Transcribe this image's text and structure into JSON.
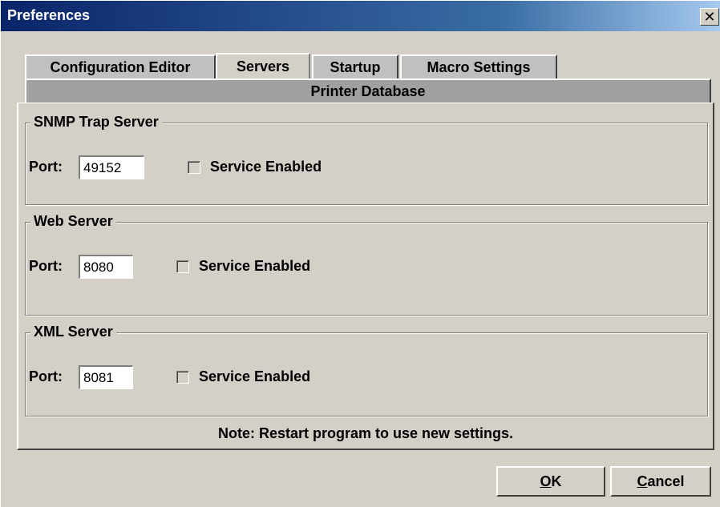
{
  "window": {
    "title": "Preferences",
    "close_glyph": "✕"
  },
  "tabs": {
    "row1": [
      {
        "label": "Configuration Editor",
        "selected": false
      },
      {
        "label": "Servers",
        "selected": true
      },
      {
        "label": "Startup",
        "selected": false
      },
      {
        "label": "Macro Settings",
        "selected": false
      }
    ],
    "row2": [
      {
        "label": "Printer Database",
        "selected": false
      }
    ]
  },
  "servers": [
    {
      "group_title": "SNMP Trap Server",
      "port_label": "Port:",
      "port_value": "49152",
      "enabled_label": "Service Enabled",
      "enabled": false
    },
    {
      "group_title": "Web Server",
      "port_label": "Port:",
      "port_value": "8080",
      "enabled_label": "Service Enabled",
      "enabled": false
    },
    {
      "group_title": "XML Server",
      "port_label": "Port:",
      "port_value": "8081",
      "enabled_label": "Service Enabled",
      "enabled": false
    }
  ],
  "note": "Note: Restart program to use new settings.",
  "buttons": {
    "ok": {
      "mnemonic": "O",
      "rest": "K"
    },
    "cancel": {
      "mnemonic": "C",
      "rest": "ancel"
    }
  },
  "colors": {
    "titlebar": "#0a246a",
    "face": "#d4d0c8",
    "tab_row2": "#a0a0a0"
  }
}
